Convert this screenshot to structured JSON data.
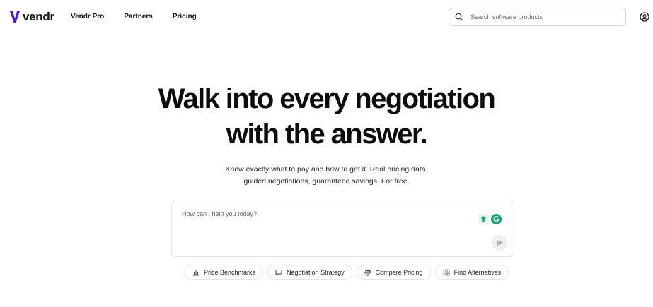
{
  "brand": {
    "name": "vendr",
    "accent": "#4b1fd6"
  },
  "nav": {
    "items": [
      {
        "label": "Vendr Pro"
      },
      {
        "label": "Partners"
      },
      {
        "label": "Pricing"
      }
    ]
  },
  "search": {
    "placeholder": "Search software products",
    "icon": "search-icon"
  },
  "hero": {
    "headline_line1": "Walk into every negotiation",
    "headline_line2": "with the answer.",
    "sub_line1": "Know exactly what to pay and how to get it. Real pricing data,",
    "sub_line2": "guided negotiations, guaranteed savings. For free."
  },
  "composer": {
    "placeholder": "How can I help you today?",
    "send_icon": "send-icon",
    "extensions": [
      "bulb-extension-icon",
      "grammarly-icon"
    ]
  },
  "chips": [
    {
      "label": "Price Benchmarks",
      "icon": "bar-chart-icon"
    },
    {
      "label": "Negotiation Strategy",
      "icon": "chat-bubble-icon"
    },
    {
      "label": "Compare Pricing",
      "icon": "scale-icon"
    },
    {
      "label": "Find Alternatives",
      "icon": "grid-icon"
    }
  ]
}
